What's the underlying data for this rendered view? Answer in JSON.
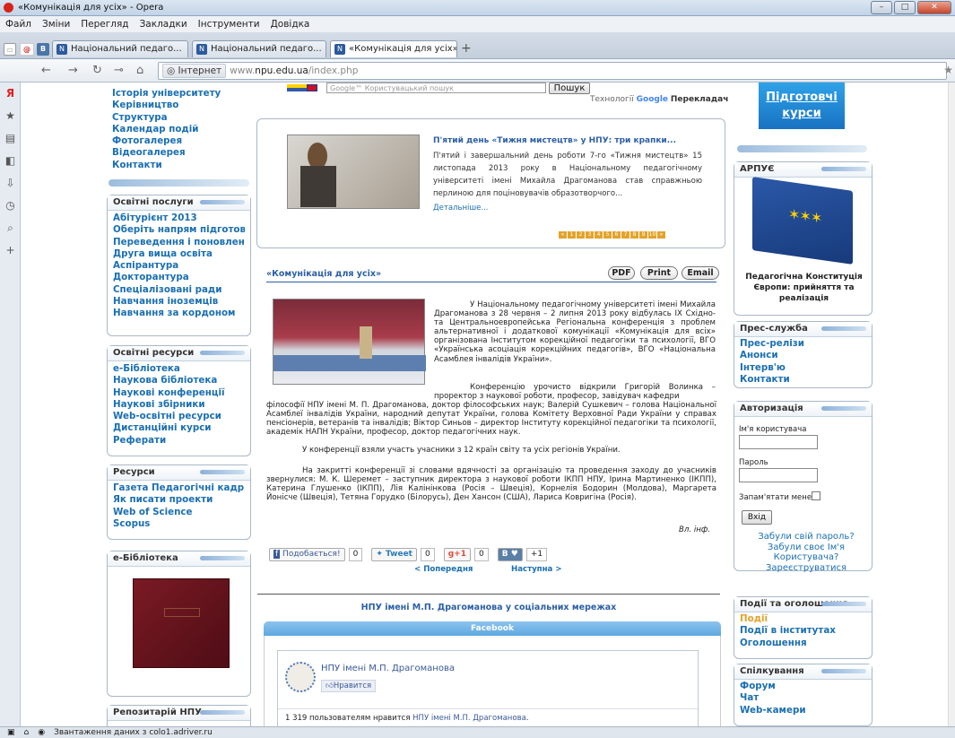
{
  "browser": {
    "window_title": "«Комунікація для усіх» - Opera",
    "menu": [
      "Файл",
      "Зміни",
      "Перегляд",
      "Закладки",
      "Інструменти",
      "Довідка"
    ],
    "tabs": [
      {
        "label": "Національний педаго...",
        "close": "×"
      },
      {
        "label": "Національний педаго...",
        "close": "×"
      },
      {
        "label": "«Комунікація для усіх»",
        "close": "×"
      }
    ],
    "add_tab": "+",
    "nav": {
      "back": "←",
      "forward": "→",
      "reload": "↻",
      "key": "⊸",
      "home": "⌂"
    },
    "address_badge": "Інтернет",
    "address_prefix": "www.",
    "address_domain": "npu.edu.ua",
    "address_path": "/index.php",
    "star": "★",
    "status_text": "Звантаження даних з colo1.adriver.ru"
  },
  "left_column": {
    "top_links": [
      "Історія університету",
      "Керівництво",
      "Структура",
      "Календар подій",
      "Фотогалерея",
      "Відеогалерея",
      "Контакти"
    ],
    "services": {
      "title": "Освітні послуги",
      "items": [
        "Абітурієнт 2013",
        "Оберіть напрям підготовки",
        "Переведення і поновлення",
        "Друга вища освіта",
        "Аспірантура",
        "Докторантура",
        "Спеціалізовані ради",
        "Навчання іноземців",
        "Навчання за кордоном"
      ]
    },
    "resources_edu": {
      "title": "Освітні ресурси",
      "items": [
        "e-Бібліотека",
        "Наукова бібліотека",
        "Наукові конференції",
        "Наукові збірники",
        "Web-освітні ресурси",
        "Дистанційні курси",
        "Реферати"
      ]
    },
    "resources": {
      "title": "Ресурси",
      "items": [
        "Газета Педагогічні кадри",
        "Як писати проекти",
        "Web of Science",
        "Scopus"
      ]
    },
    "elib": {
      "title": "e-Бібліотека"
    },
    "repo": {
      "title": "Репозитарій НПУ"
    }
  },
  "center": {
    "search_placeholder": "Google™ Користувацький пошук",
    "search_button": "Пошук",
    "translate_label": "Технології",
    "translate_google": "Google",
    "translate_word": "Перекладач",
    "news": {
      "title": "П'ятий день «Тижня мистецтв» у НПУ: три крапки...",
      "text": "П'ятий і завершальний день роботи 7-го «Тижня мистецтв» 15 листопада 2013 року в Національному педагогічному університеті імені Михайла Драгоманова став справжньою перлиною для поціновувачів образотворчого...",
      "more": "Детальніше...",
      "pages": [
        "«",
        "1",
        "2",
        "3",
        "4",
        "5",
        "6",
        "7",
        "8",
        "9",
        "10",
        "»"
      ]
    },
    "article": {
      "title": "«Комунікація для усіх»",
      "pdf": "PDF",
      "print": "Print",
      "email": "Email",
      "p1": "У Національному педагогічному університеті імені Михайла Драгоманова з 28 червня – 2 липня 2013 року відбулась IX Східно- та Центральноевропейська Регіональна конференція з проблем альтернативної і додаткової комунікації «Комунікація для всіх» організована Інститутом корекційної педагогіки та психології, ВГО «Українська асоціація корекційних педагогів», ВГО «Національна Асамблея інвалідів України».",
      "p2a": "Конференцію урочисто відкрили Григорій Волинка – проректор з наукової роботи, професор, завідувач кафедри",
      "p2b": "філософії НПУ імені М. П. Драгоманова, доктор філософських наук; Валерій Сушкевич – голова Національної Асамблеї інвалідів України, народний депутат України, голова Комітету Верховної Ради України у справах пенсіонерів, ветеранів та інвалідів; Віктор Синьов – директор Інституту корекційної педагогіки та психології, академік НАПН України, професор, доктор педагогічних наук.",
      "p3": "У конференції взяли участь учасники з 12 країн світу та усіх регіонів України.",
      "p4": "На закритті конференції зі словами вдячності за організацію та проведення заходу до учасників звернулися: М. К. Шеремет – заступник директора з наукової роботи ІКПП НПУ, Ірина Мартиненко (ІКПП), Катерина Глушенко (ІКПП), Лія Калінінкова (Росія – Швеція), Корнелія Бодорин (Молдова), Маргарета Йонісче (Швеція), Тетяна Горудко (Білорусь), Ден Хансон (США), Лариса Ковригіна (Росія).",
      "sign": "Вл. інф."
    },
    "social": {
      "fb_like": "Подобається!",
      "fb_count": "0",
      "tweet": "Tweet",
      "tweet_count": "0",
      "gplus": "+1",
      "gplus_count": "0",
      "vk": "B",
      "vk_heart": "♥",
      "vk_count": "+1"
    },
    "prev": "< Попередня",
    "next": "Наступна >",
    "networks_title": "НПУ імені М.П. Драгоманова у соціальних мережах",
    "facebook_tab": "Facebook",
    "fb_page_name": "НПУ імені М.П. Драгоманова",
    "fb_like_btn": "Нравится",
    "fb_likes_prefix": "1 319 пользователям нравится ",
    "fb_likes_link": "НПУ імені М.П. Драгоманова",
    "fb_likes_suffix": "."
  },
  "right_column": {
    "courses_line1": "Підготовчі",
    "courses_line2": "курси",
    "arpue": {
      "title": "АРПУЄ",
      "caption": "Педагогічна Конституція Європи: прийняття та реалізація"
    },
    "press": {
      "title": "Прес-служба",
      "items": [
        "Прес-релізи",
        "Анонси",
        "Інтерв'ю",
        "Контакти"
      ]
    },
    "auth": {
      "title": "Авторизація",
      "user_label": "Ім'я користувача",
      "pass_label": "Пароль",
      "remember": "Запам'ятати мене",
      "login_btn": "Вхід",
      "links": [
        "Забули свій пароль?",
        "Забули своє Ім'я",
        "Користувача?",
        "Зареєструватися"
      ]
    },
    "events": {
      "title": "Події та оголошення",
      "items": [
        "Події",
        "Події в інститутах",
        "Оголошення"
      ]
    },
    "talk": {
      "title": "Спілкування",
      "items": [
        "Форум",
        "Чат",
        "Web-камери"
      ]
    }
  },
  "colors": {
    "link": "#1a6fb2",
    "accent_orange": "#e3a32a",
    "title_blue": "#2b5fa6"
  }
}
